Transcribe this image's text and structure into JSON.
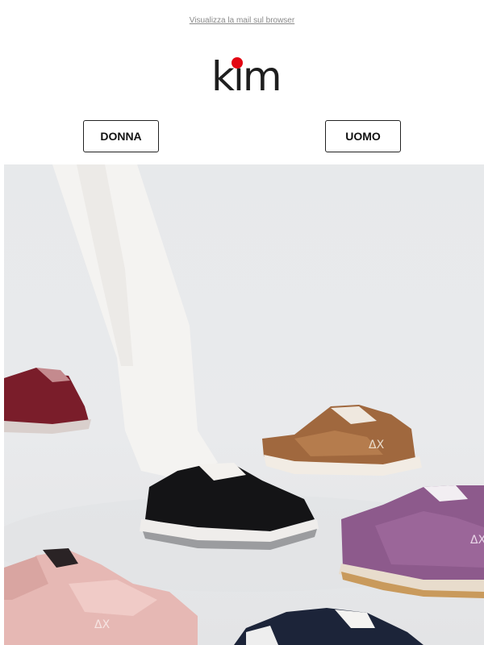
{
  "header": {
    "view_in_browser": "Visualizza la mail sul browser"
  },
  "logo": {
    "text": "kim",
    "dot_color": "#e30613"
  },
  "nav": {
    "women": "DONNA",
    "men": "UOMO"
  },
  "hero": {
    "alt": "sneakers collection photo",
    "badge_brown": "ΔX",
    "badge_purple": "ΔX",
    "badge_pink": "ΔX"
  }
}
